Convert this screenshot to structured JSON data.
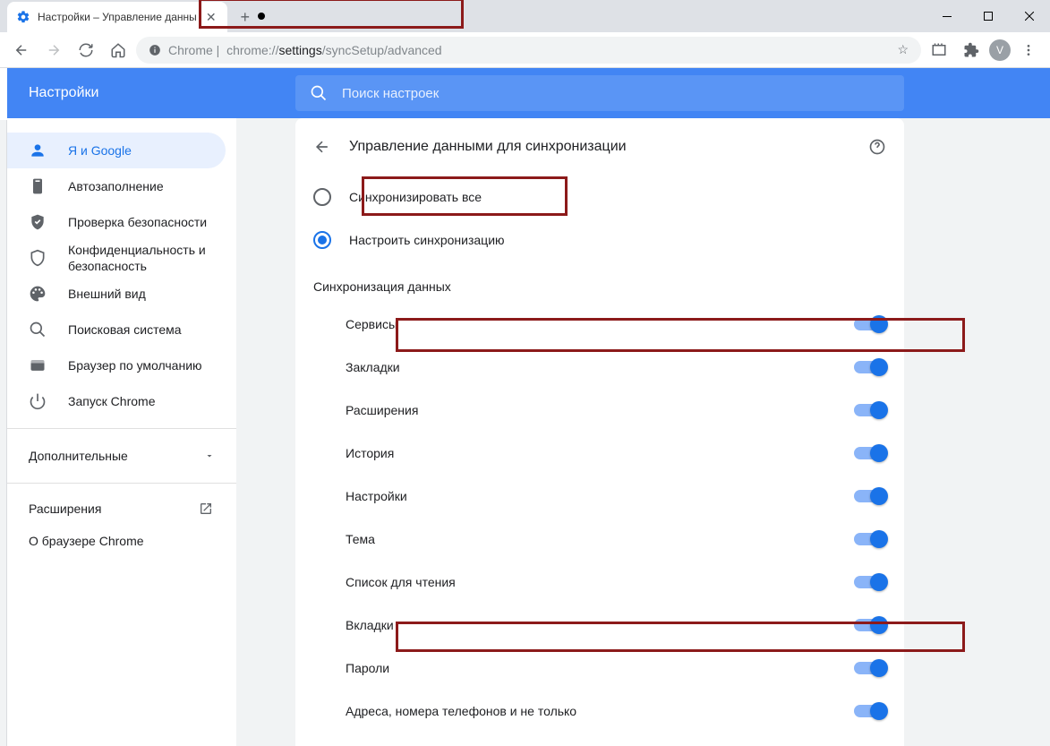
{
  "tab": {
    "title": "Настройки – Управление данны"
  },
  "omnibox": {
    "prefix": "Chrome |",
    "url_dim1": "chrome://",
    "url_dark": "settings",
    "url_dim2": "/syncSetup/advanced"
  },
  "avatar_letter": "V",
  "header": {
    "title": "Настройки",
    "search_placeholder": "Поиск настроек"
  },
  "sidebar": {
    "items": [
      {
        "label": "Я и Google"
      },
      {
        "label": "Автозаполнение"
      },
      {
        "label": "Проверка безопасности"
      },
      {
        "label": "Конфиденциальность и безопасность"
      },
      {
        "label": "Внешний вид"
      },
      {
        "label": "Поисковая система"
      },
      {
        "label": "Браузер по умолчанию"
      },
      {
        "label": "Запуск Chrome"
      }
    ],
    "advanced": "Дополнительные",
    "extensions": "Расширения",
    "about": "О браузере Chrome"
  },
  "page": {
    "title": "Управление данными для синхронизации",
    "radios": [
      {
        "label": "Синхронизировать все",
        "checked": false
      },
      {
        "label": "Настроить синхронизацию",
        "checked": true
      }
    ],
    "section": "Синхронизация данных",
    "toggles": [
      {
        "label": "Сервисы",
        "on": true
      },
      {
        "label": "Закладки",
        "on": true
      },
      {
        "label": "Расширения",
        "on": true
      },
      {
        "label": "История",
        "on": true
      },
      {
        "label": "Настройки",
        "on": true
      },
      {
        "label": "Тема",
        "on": true
      },
      {
        "label": "Список для чтения",
        "on": true
      },
      {
        "label": "Вкладки",
        "on": true
      },
      {
        "label": "Пароли",
        "on": true
      },
      {
        "label": "Адреса, номера телефонов и не только",
        "on": true
      }
    ]
  }
}
